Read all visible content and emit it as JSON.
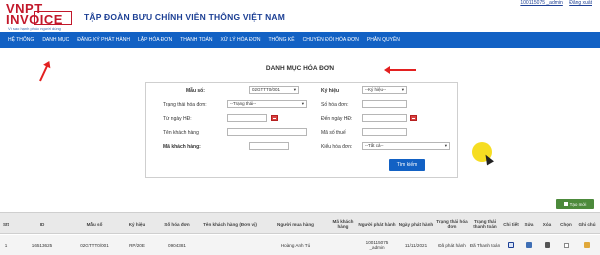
{
  "header": {
    "logo_line1": "VNPT",
    "logo_line2": "INVOICE",
    "logo_tagline": "Vì sao hạnh phúc người dùng",
    "org_title": "TẬP ĐOÀN BƯU CHÍNH VIỄN THÔNG VIỆT NAM",
    "user_link": "100115075 _admin",
    "logout_link": "Đăng xuất"
  },
  "menu": [
    "HỆ THỐNG",
    "DANH MỤC",
    "ĐĂNG KÝ PHÁT HÀNH",
    "LẬP HÓA ĐƠN",
    "THANH TOÁN",
    "XỬ LÝ HÓA ĐƠN",
    "THỐNG KÊ",
    "CHUYỂN ĐỔI HÓA ĐƠN",
    "PHÂN QUYỀN"
  ],
  "section_title": "DANH MỤC HÓA ĐƠN",
  "form": {
    "mau_so_label": "Mẫu số:",
    "mau_so_value": "02GTTT0/001",
    "ky_hieu_label": "Ký hiệu",
    "ky_hieu_value": "--Ký hiệu--",
    "trang_thai_label": "Trạng thái hóa đơn:",
    "trang_thai_value": "--Trạng thái--",
    "so_hoa_don_label": "Số hóa đơn:",
    "so_hoa_don_value": "",
    "tu_ngay_label": "Từ ngày HĐ:",
    "tu_ngay_value": "",
    "den_ngay_label": "Đến ngày HĐ:",
    "den_ngay_value": "",
    "ten_kh_label": "Tên khách hàng",
    "ten_kh_value": "",
    "ma_so_thue_label": "Mã số thuế",
    "ma_so_thue_value": "",
    "ma_kh_label": "Mã khách hàng:",
    "ma_kh_value": "",
    "kieu_hd_label": "Kiểu hóa đơn:",
    "kieu_hd_value": "--Tất cả--",
    "search_button": "Tìm kiếm"
  },
  "add_button": "Tạo mới",
  "table": {
    "headers": [
      "Stt",
      "ID",
      "Mẫu số",
      "Ký hiệu",
      "Số hóa đơn",
      "Tên khách hàng (Đơn vị)",
      "Người mua hàng",
      "Mã khách hàng",
      "Người phát hành",
      "Ngày phát hành",
      "Trạng thái hóa đơn",
      "Trạng thái thanh toán",
      "Chi tiết",
      "Sửa",
      "Xóa",
      "Chọn",
      "Ghi chú"
    ],
    "rows": [
      {
        "stt": "1",
        "id": "16513625",
        "mau_so": "02GTTT0/001",
        "ky_hieu": "RP/20E",
        "so_hd": "0904381",
        "ten_kh": "",
        "nguoi_mua": "Hoàng Anh Tú",
        "ma_kh": "",
        "nguoi_ph": "100115075 _admin",
        "ngay_ph": "11/11/2021",
        "tt_hd": "Đã phát hành",
        "tt_tt": "Đã Thanh toán"
      }
    ]
  },
  "colors": {
    "brand_red": "#c2182b",
    "menu_blue": "#1261c4",
    "annotation_red": "#e32020",
    "cursor_highlight": "#f5d90a",
    "add_green": "#4c8a3b"
  }
}
